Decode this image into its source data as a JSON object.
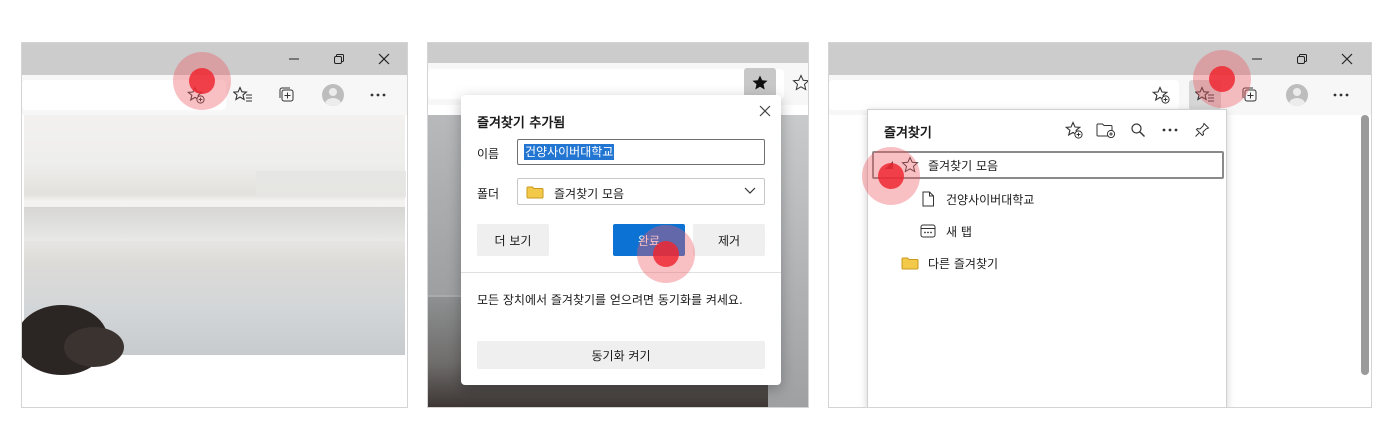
{
  "panel1": {
    "window_controls": {
      "minimize": "—",
      "restore": "⧉",
      "close": "✕"
    }
  },
  "panel2": {
    "dialog": {
      "title": "즐겨찾기 추가됨",
      "name_label": "이름",
      "name_value": "건양사이버대학교",
      "folder_label": "폴더",
      "folder_value": "즐겨찾기 모음",
      "more_button": "더 보기",
      "done_button": "완료",
      "remove_button": "제거",
      "sync_message": "모든 장치에서 즐겨찾기를 얻으려면 동기화를 켜세요.",
      "sync_button": "동기화 켜기"
    }
  },
  "panel3": {
    "favorites": {
      "title": "즐겨찾기",
      "items": [
        {
          "label": "즐겨찾기 모음",
          "icon": "star-outline-icon"
        },
        {
          "label": "건양사이버대학교",
          "icon": "page-icon"
        },
        {
          "label": "새 탭",
          "icon": "new-tab-icon"
        },
        {
          "label": "다른 즐겨찾기",
          "icon": "folder-icon"
        }
      ]
    }
  },
  "colors": {
    "accent_blue": "#0c72d3",
    "selection_blue": "#2276d2",
    "click_marker_red": "#ee2832",
    "folder_yellow": "#f3c94a",
    "titlebar_grey": "#cccccc"
  }
}
